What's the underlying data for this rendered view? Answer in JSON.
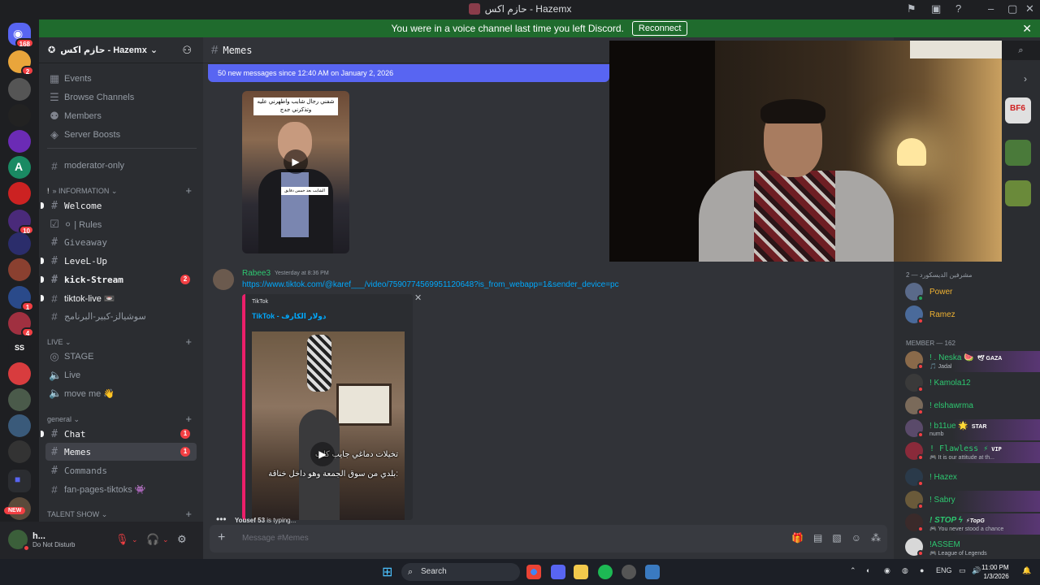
{
  "window": {
    "title": "حازم اكس - Hazemx"
  },
  "banner": {
    "text": "You were in a voice channel last time you left Discord.",
    "reconnect": "Reconnect"
  },
  "rail": {
    "badges": {
      "top": "168",
      "s2": "2",
      "s10": "10",
      "s1": "1",
      "s4": "4",
      "new": "NEW"
    },
    "ss_label": "SS"
  },
  "server": {
    "name": "حازم اكس - Hazemx"
  },
  "sidebar": {
    "nav": [
      "Events",
      "Browse Channels",
      "Members",
      "Server Boosts"
    ],
    "channels": {
      "moderator": "moderator-only",
      "cat_info": "» information",
      "welcome": "Welcome",
      "rules": "⚪ | Rules",
      "giveaway": "Giveaway",
      "levelup": "LeveL-Up",
      "kick": "kick-Stream",
      "kick_badge": "2",
      "tiktoklive": "tiktok-live 📼",
      "arabic": "سوشيالز-كبير-البرنامج",
      "cat_live": "LIVE",
      "stage": "STAGE",
      "live": "Live",
      "moveme": "move me 👋",
      "cat_general": "general",
      "chat": "Chat",
      "chat_badge": "1",
      "memes": "Memes",
      "memes_badge": "1",
      "commands": "Commands",
      "fanpages": "fan-pages-tiktoks 👾",
      "cat_talent": "TALENT SHOW"
    }
  },
  "user": {
    "name": "h...",
    "status": "Do Not Disturb"
  },
  "chat": {
    "channel": "Memes",
    "new_messages": "50 new messages since 12:40 AM on January 2, 2026",
    "video1": {
      "caption": "شفني رجال شايب واطهرني عليه وتذكرني جدج",
      "sub": "الشايب بعد خمس دقايق"
    },
    "message": {
      "author": "Rabee3",
      "time": "Yesterday at 8:36 PM",
      "link": "https://www.tiktok.com/@karef___/video/7590774569951120648?is_from_webapp=1&sender_device=pc",
      "embed_provider": "TikTok",
      "embed_title": "TikTok - دولار الكارف",
      "caption1": "تخيلات دماغي جايب كلب",
      "caption2": "بلدي من سوق الجمعة وهو داخل خناقة:"
    },
    "typing": {
      "user": "Yousef 53",
      "text": " is typing..."
    },
    "placeholder": "Message #Memes"
  },
  "members": {
    "group1": "مشرفين الديسكورد — 2",
    "group2": "MEMBER — 162",
    "list1": [
      {
        "name": "Power",
        "color": "#f0b232"
      },
      {
        "name": "Ramez",
        "color": "#f0b232"
      }
    ],
    "list2": [
      {
        "name": "! . Neska 🍉",
        "sub": "🎵 Jadal",
        "tag": "🕊 GAZA",
        "color": "#2dc770"
      },
      {
        "name": "! Kamola12",
        "sub": "",
        "tag": "",
        "color": "#2dc770"
      },
      {
        "name": "! elshawrma",
        "sub": "",
        "tag": "",
        "color": "#2dc770"
      },
      {
        "name": "! b11ue 🌟",
        "sub": "numb",
        "tag": "STAR",
        "color": "#2dc770"
      },
      {
        "name": "! Flawless ⚡",
        "sub": "🎮 It is our attitude at th...",
        "tag": "VIP",
        "color": "#2dc770"
      },
      {
        "name": "! Hazex",
        "sub": "",
        "tag": "",
        "color": "#2dc770"
      },
      {
        "name": "! Sabry",
        "sub": "",
        "tag": "",
        "color": "#2dc770"
      },
      {
        "name": "! STOP ϟ",
        "sub": "🎮 You never stood a chance",
        "tag": "⚡TopG",
        "color": "#2dc770"
      },
      {
        "name": "!ASSEM",
        "sub": "🎮 League of Legends",
        "tag": "",
        "color": "#2dc770"
      }
    ]
  },
  "taskbar": {
    "search": "Search",
    "lang": "ENG",
    "time": "11:00 PM",
    "date": "1/3/2026"
  }
}
